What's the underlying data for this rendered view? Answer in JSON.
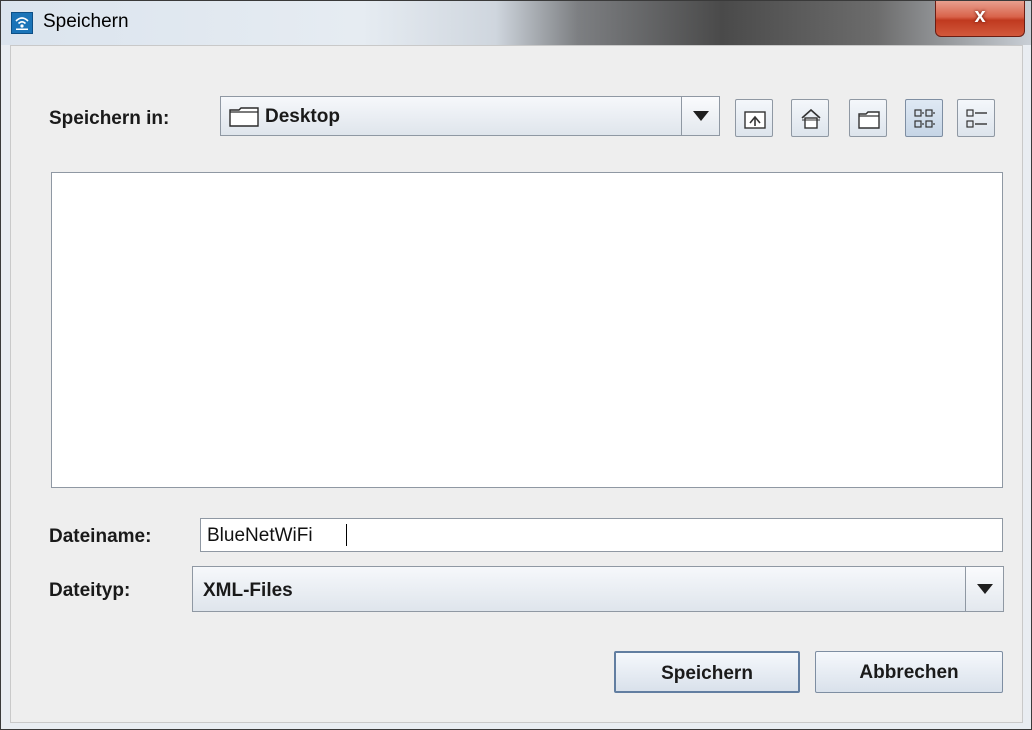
{
  "window": {
    "title": "Speichern",
    "close_label": "x"
  },
  "lookin": {
    "label": "Speichern in:",
    "value": "Desktop"
  },
  "toolbar": {
    "icons": [
      "up-folder-icon",
      "home-icon",
      "new-folder-icon",
      "list-view-icon",
      "details-view-icon"
    ]
  },
  "filename": {
    "label": "Dateiname:",
    "value": "BlueNetWiFi"
  },
  "filetype": {
    "label": "Dateityp:",
    "value": "XML-Files"
  },
  "buttons": {
    "save": "Speichern",
    "cancel": "Abbrechen"
  }
}
